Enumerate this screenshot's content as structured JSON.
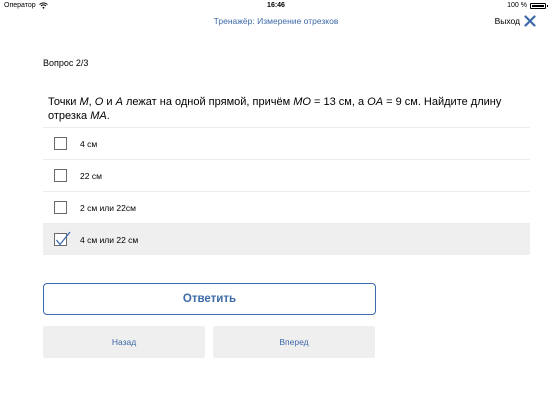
{
  "status_bar": {
    "carrier": "Оператор",
    "time": "16:46",
    "battery": "100 %",
    "battery_level": 1.0
  },
  "nav": {
    "title": "Тренажёр: Измерение отрезков",
    "exit_label": "Выход"
  },
  "question": {
    "number": "Вопрос 2/3",
    "text_parts": {
      "p1": "Точки ",
      "m": "M",
      "p2": ", ",
      "o": "O",
      "p3": " и ",
      "a": "A",
      "p4": " лежат на одной прямой, причём ",
      "mo": "MO",
      "p5": " = 13 см, а ",
      "oa": "OA",
      "p6": " = 9 см. Найдите длину отрезка ",
      "ma": "MA",
      "p7": "."
    }
  },
  "options": [
    {
      "label": "4 см",
      "checked": false
    },
    {
      "label": "22 см",
      "checked": false
    },
    {
      "label": "2 см или 22см",
      "checked": false
    },
    {
      "label": "4 см или 22 см",
      "checked": true
    }
  ],
  "buttons": {
    "answer": "Ответить",
    "back": "Назад",
    "forward": "Вперед"
  },
  "colors": {
    "accent": "#3d6aa8",
    "selected_bg": "#efefef"
  }
}
